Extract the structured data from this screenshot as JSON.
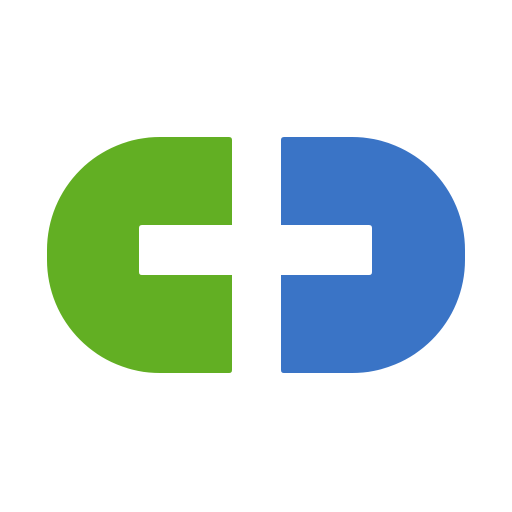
{
  "logo": {
    "icon": "interlocking-c-shapes-logo-icon",
    "left_color": "#62AF23",
    "right_color": "#3A74C6",
    "background_color": "#FFFFFF"
  }
}
